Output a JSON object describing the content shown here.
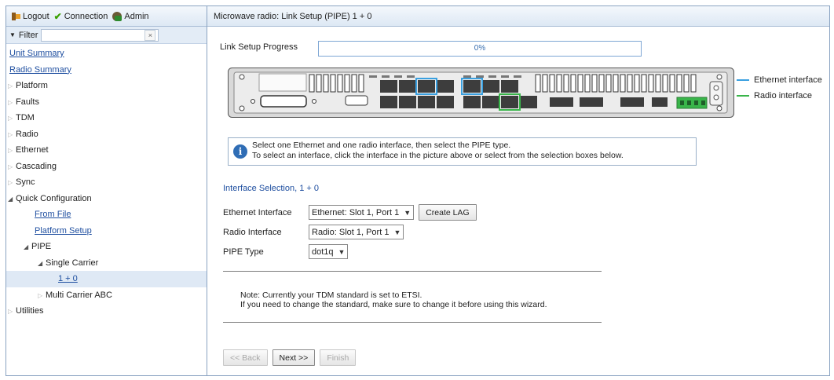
{
  "toolbar": {
    "logout": "Logout",
    "connection": "Connection",
    "admin": "Admin"
  },
  "filter": {
    "label": "Filter",
    "value": "",
    "clear": "×"
  },
  "nav": {
    "unit_summary": "Unit Summary",
    "radio_summary": "Radio Summary",
    "platform": "Platform",
    "faults": "Faults",
    "tdm": "TDM",
    "radio": "Radio",
    "ethernet": "Ethernet",
    "cascading": "Cascading",
    "sync": "Sync",
    "quick_configuration": "Quick Configuration",
    "from_file": "From File",
    "platform_setup": "Platform Setup",
    "pipe": "PIPE",
    "single_carrier": "Single Carrier",
    "one_plus_zero": "1 + 0",
    "multi_carrier_abc": "Multi Carrier ABC",
    "utilities": "Utilities"
  },
  "page": {
    "title": "Microwave radio: Link Setup (PIPE) 1 + 0",
    "progress_label": "Link Setup Progress",
    "progress_text": "0%",
    "progress_value": 0
  },
  "legend": {
    "ethernet": "Ethernet interface",
    "radio": "Radio interface",
    "ethernet_color": "#3aa0e0",
    "radio_color": "#39b54a"
  },
  "info": {
    "line1": "Select one Ethernet and one radio interface, then select the PIPE type.",
    "line2": "To select an interface, click the interface in the picture above or select from the selection boxes below."
  },
  "form": {
    "section_title": "Interface Selection, 1 + 0",
    "ethernet_label": "Ethernet Interface",
    "ethernet_value": "Ethernet: Slot 1, Port 1",
    "create_lag": "Create LAG",
    "radio_label": "Radio Interface",
    "radio_value": "Radio: Slot 1, Port 1",
    "pipe_label": "PIPE Type",
    "pipe_value": "dot1q"
  },
  "note": {
    "line1": "Note: Currently your TDM standard is set to ETSI.",
    "line2": "If you need to change the standard, make sure to change it before using this wizard."
  },
  "wizard": {
    "back": "<< Back",
    "next": "Next >>",
    "finish": "Finish"
  },
  "icons": [
    "logout-icon",
    "check-icon",
    "admin-icon",
    "info-icon",
    "chevron-down-icon"
  ]
}
